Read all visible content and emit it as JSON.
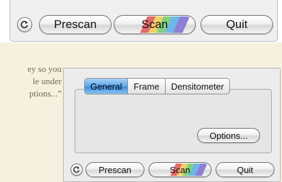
{
  "toolbar_top": {
    "prescan_label": "Prescan",
    "scan_label": "Scan",
    "quit_label": "Quit",
    "refresh_icon": "circular-arrow-icon"
  },
  "help_text": {
    "line1": "ey so you",
    "line2": "le under",
    "line3": "ptions...”"
  },
  "dialog": {
    "tabs": [
      {
        "label": "General",
        "active": true
      },
      {
        "label": "Frame",
        "active": false
      },
      {
        "label": "Densitometer",
        "active": false
      }
    ],
    "options_label": "Options...",
    "prescan_label": "Prescan",
    "scan_label": "Scan",
    "quit_label": "Quit"
  },
  "colors": {
    "panel_bg": "#efefef",
    "band_bg": "#f6f1de",
    "active_tab": "#5ea7ea",
    "scan_stripes": [
      "#e46a6a",
      "#f2d06b",
      "#7fd07f",
      "#6fb6e8",
      "#8d7fd6"
    ]
  }
}
